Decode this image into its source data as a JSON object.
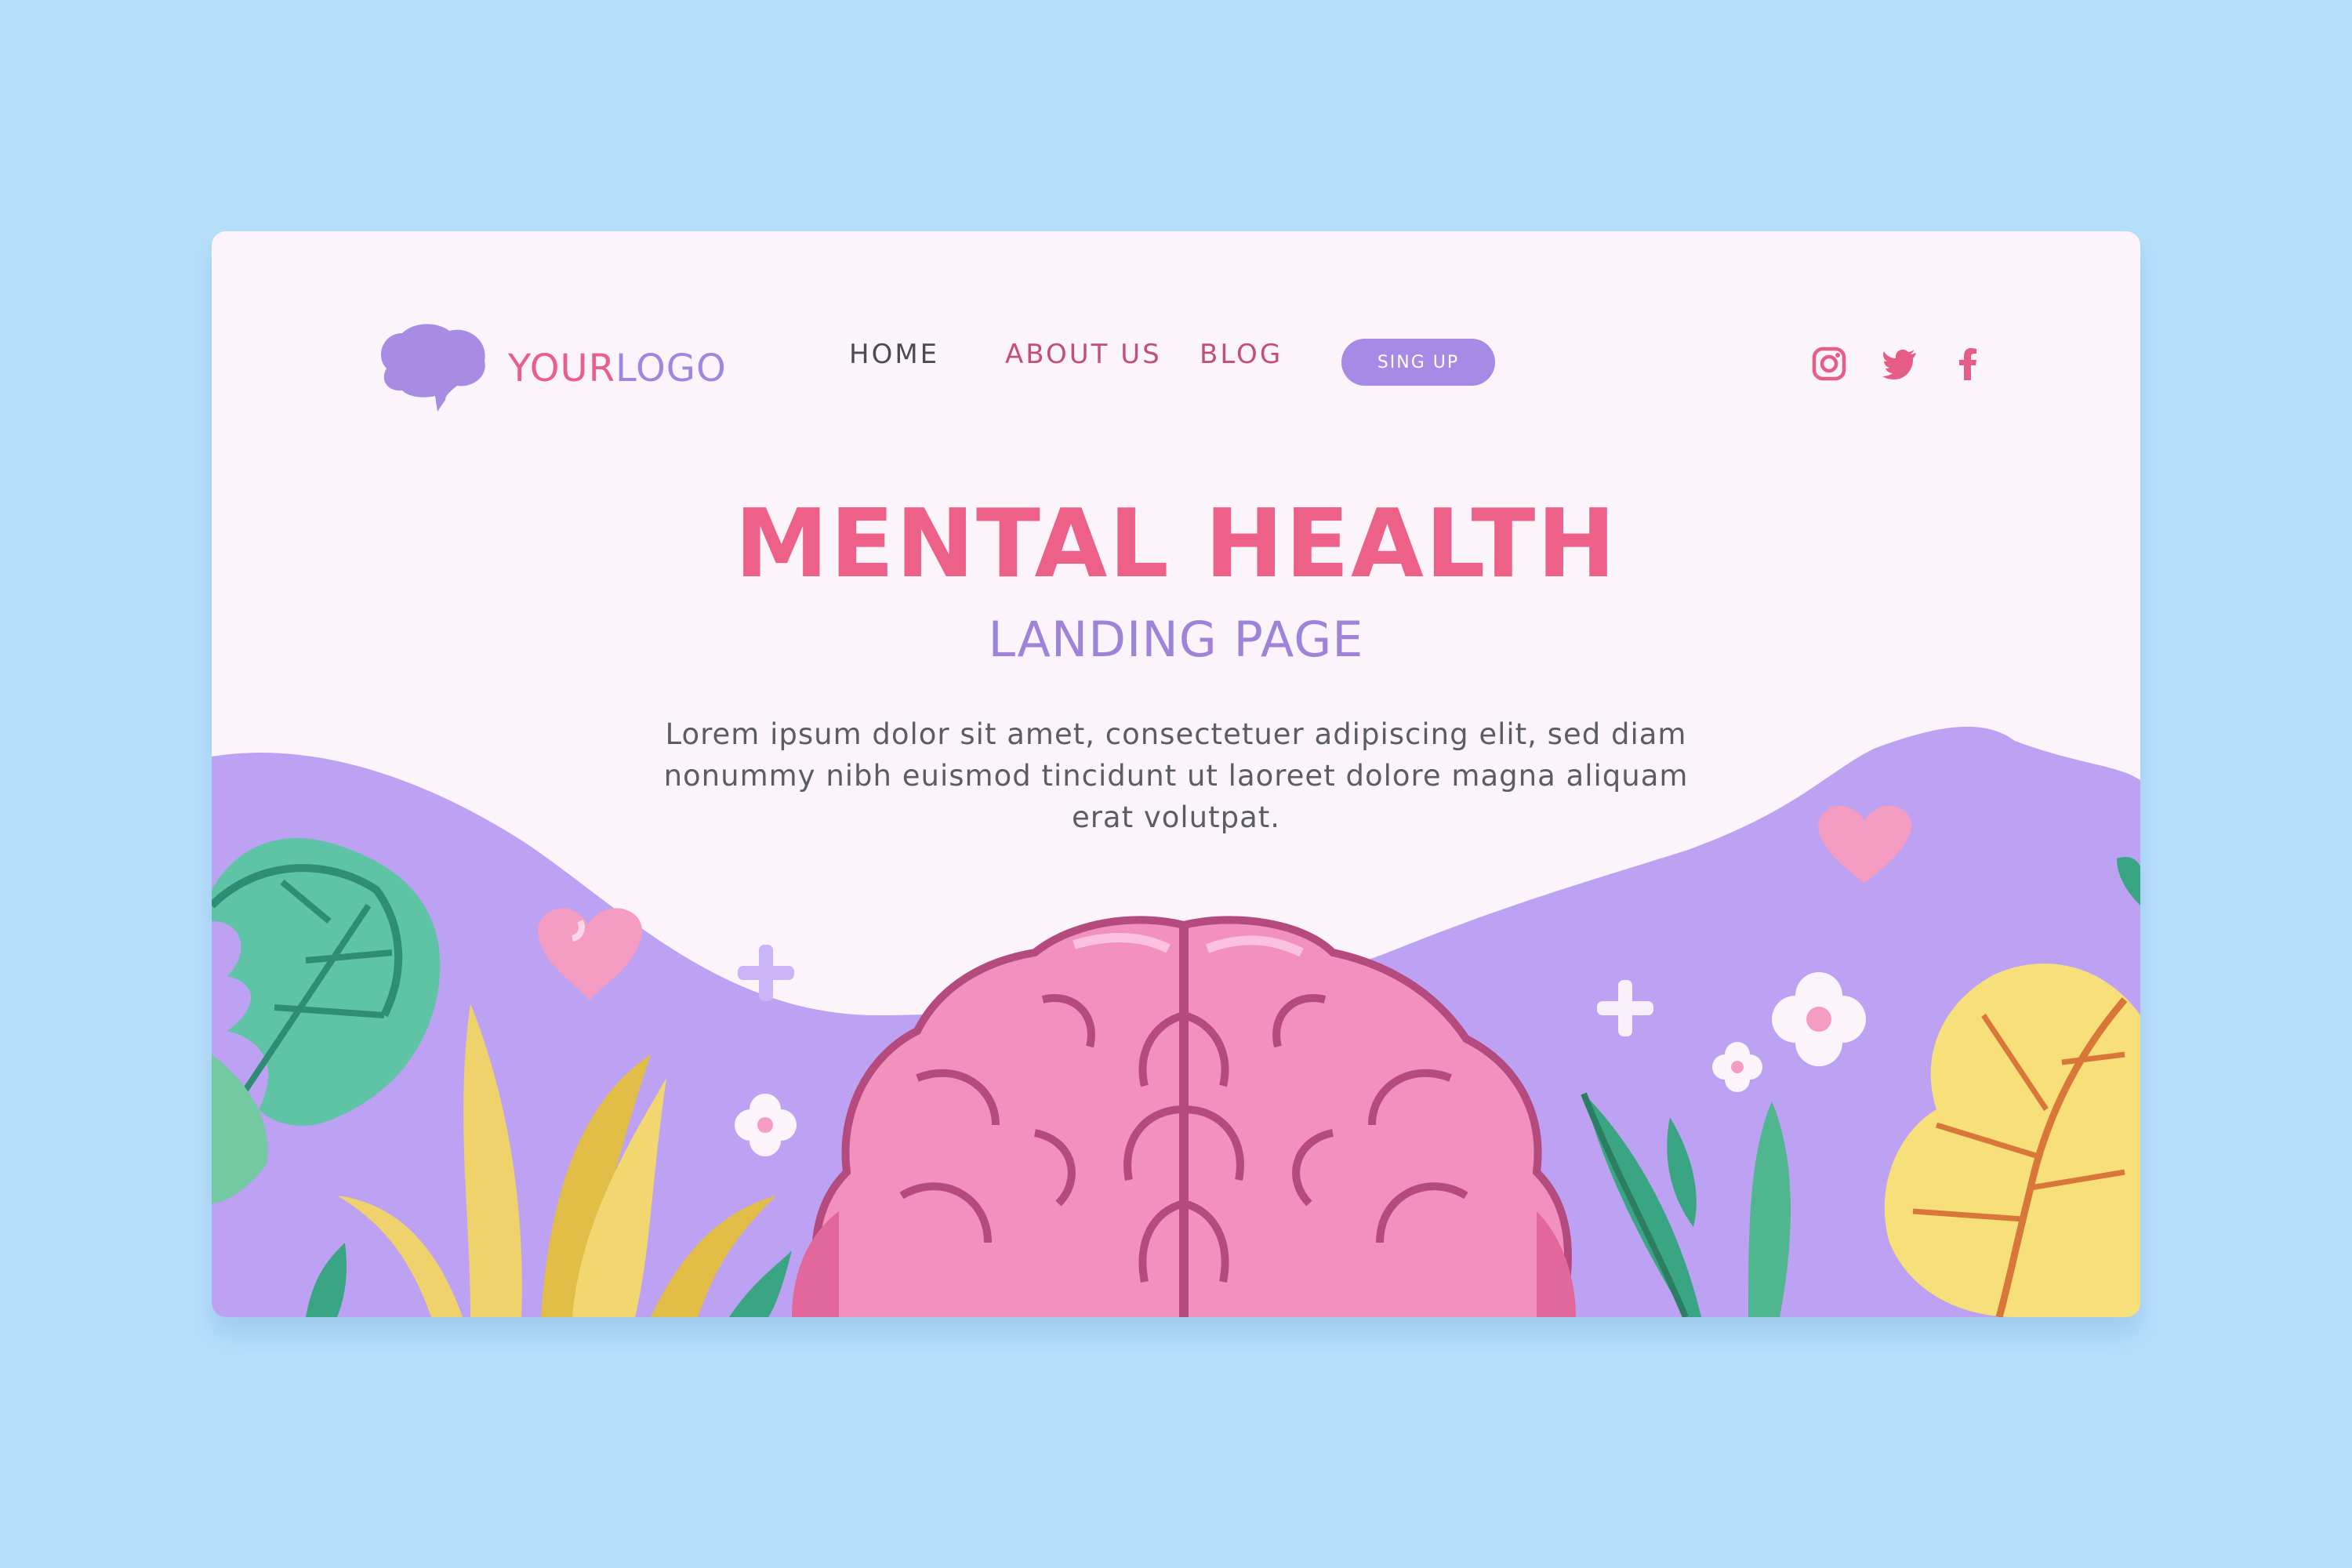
{
  "logo": {
    "brand_part1": "YOUR",
    "brand_part2": "LOGO",
    "icon": "brain-icon"
  },
  "nav": {
    "items": [
      {
        "label": "HOME"
      },
      {
        "label": "ABOUT US"
      },
      {
        "label": "BLOG"
      }
    ],
    "signup_label": "SING UP"
  },
  "social": [
    "instagram-icon",
    "twitter-icon",
    "facebook-icon"
  ],
  "hero": {
    "title": "MENTAL HEALTH",
    "subtitle": "LANDING PAGE",
    "body": "Lorem ipsum dolor sit amet, consectetuer adipiscing elit, sed diam nonummy nibh euismod tincidunt ut laoreet dolore magna aliquam erat volutpat."
  },
  "colors": {
    "background": "#b6dffb",
    "card": "#fbf5fb",
    "accent_pink": "#ed6189",
    "accent_purple": "#a58ae6",
    "wave_purple": "#bda2f3"
  }
}
